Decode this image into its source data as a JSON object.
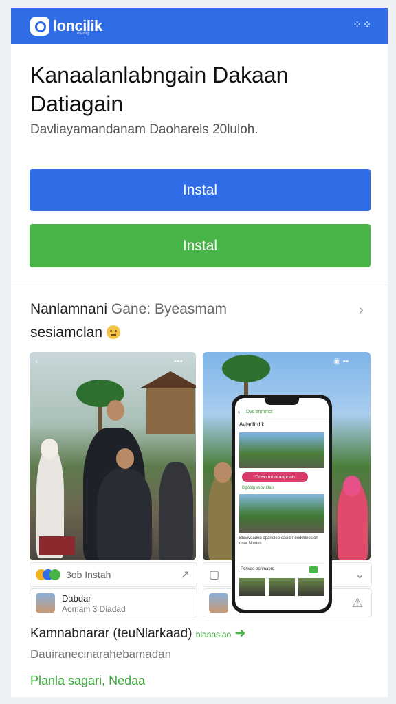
{
  "header": {
    "brand": "loncilik",
    "brand_sub": "esbstg",
    "menu_icon": "dots-grid-icon"
  },
  "hero": {
    "title": "Kanaalanlabngain Dakaan Datiagain",
    "subtitle": "Davliayamandanam Daoharels 20luloh.",
    "primary_button": "Instal",
    "secondary_button": "Instal"
  },
  "section": {
    "heading_main": "Nanlamnani",
    "heading_muted": " Gane: Byeasmam",
    "subheading": "sesiamclan",
    "more_icon": "chevron-right-icon"
  },
  "cards": [
    {
      "caption": "3ob Instah",
      "user_name": "Dabdar",
      "user_meta": "Aomam 3 Diadad"
    },
    {
      "caption": "",
      "user_name": "",
      "user_meta": ""
    }
  ],
  "phone": {
    "app_name": "Aviadlirdik",
    "topbar_label": "Dvs snmmoi",
    "pill": "Doeoimnoraopnan",
    "line": "Dgoolg vsov  Oao",
    "text": "Blevivoadoo opanoleo sasid Pooddrinosion onar Nomes",
    "bar_text": "Ponvoo bonmaoro"
  },
  "footer": {
    "title": "Kamnabnarar (teuNlarkaad)",
    "title_tag": "blanasiao",
    "description": "Dauiranecinarahebamadan",
    "link": "Planla sagari, Nedaa"
  },
  "colors": {
    "brand_blue": "#2f6ce5",
    "green": "#49b548",
    "pink": "#d93a6a"
  }
}
